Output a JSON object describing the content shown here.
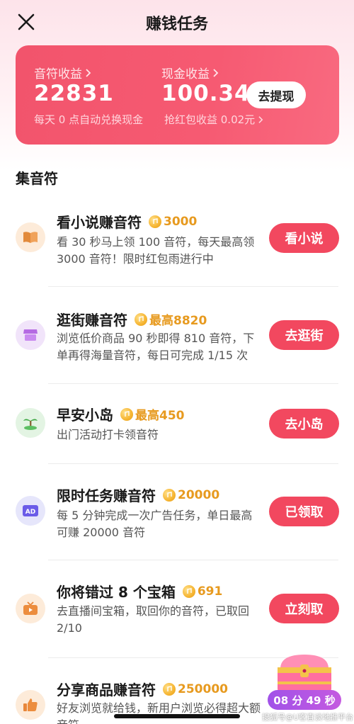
{
  "header": {
    "title": "赚钱任务"
  },
  "earnings": {
    "note_label": "音符收益",
    "note_value": "22831",
    "note_sub": "每天 0 点自动兑换现金",
    "cash_label": "现金收益",
    "cash_value": "100.34",
    "cash_sub": "抢红包收益 0.02元",
    "withdraw_label": "去提现"
  },
  "section": {
    "title": "集音符"
  },
  "tasks": [
    {
      "title": "看小说赚音符",
      "reward": "3000",
      "desc": "看 30 秒马上领 100 音符，每天最高领 3000 音符！限时红包雨进行中",
      "button": "看小说"
    },
    {
      "title": "逛街赚音符",
      "reward": "最高8820",
      "desc": "浏览低价商品 90 秒即得 810 音符，下单再得海量音符，每日可完成 1/15 次",
      "button": "去逛街"
    },
    {
      "title": "早安小岛",
      "reward": "最高450",
      "desc": "出门活动打卡领音符",
      "button": "去小岛"
    },
    {
      "title": "限时任务赚音符",
      "reward": "20000",
      "desc": "每 5 分钟完成一次广告任务，单日最高可赚 20000 音符",
      "button": "已领取"
    },
    {
      "title": "你将错过 8 个宝箱",
      "reward": "691",
      "desc": "去直播间宝箱，取回你的音符，已取回 2/10",
      "button": "立刻取"
    },
    {
      "title": "分享商品赚音符",
      "reward": "250000",
      "desc": "好友浏览就给钱，新用户浏览必得超大额音符",
      "button": ""
    }
  ],
  "timer": {
    "text": "08 分 49 秒"
  },
  "watermark": "搜狐号@U客直谈地推平台",
  "colors": {
    "accent": "#f2485f",
    "card": "#f2546c",
    "reward": "#e79a1f"
  },
  "icons": [
    "close-icon",
    "book-icon",
    "shop-icon",
    "island-icon",
    "ad-icon",
    "live-tv-icon",
    "thumbs-up-icon",
    "coin-icon",
    "treasure-chest-icon"
  ]
}
